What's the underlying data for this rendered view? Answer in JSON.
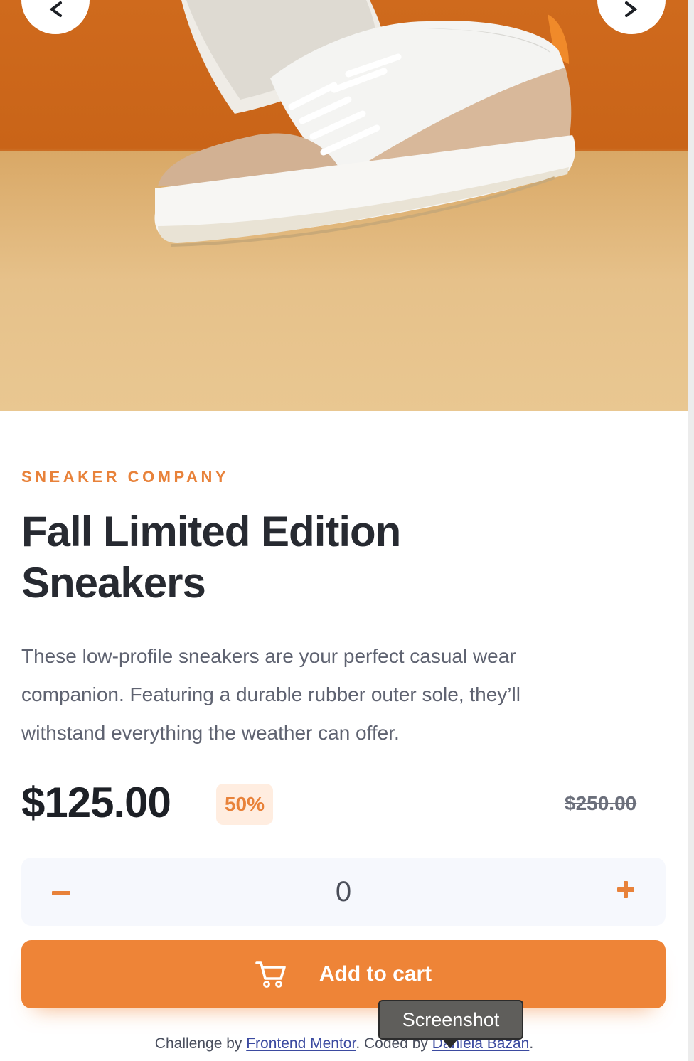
{
  "gallery": {
    "image_alt": "Fall Limited Edition Sneakers product photo",
    "prev_icon": "chevron-left-icon",
    "next_icon": "chevron-right-icon"
  },
  "product": {
    "company": "SNEAKER COMPANY",
    "title": "Fall Limited Edition Sneakers",
    "description": "These low-profile sneakers are your perfect casual wear companion. Featuring a durable rubber outer sole, they’ll withstand everything the weather can offer.",
    "price": "$125.00",
    "discount": "50%",
    "old_price": "$250.00"
  },
  "quantity": {
    "value": "0",
    "minus_icon": "minus-icon",
    "plus_icon": "plus-icon"
  },
  "cart_button": {
    "label": "Add to cart",
    "icon": "cart-icon"
  },
  "footer": {
    "challenge_prefix": "Challenge by",
    "challenge_link": "Frontend Mentor",
    "coded_prefix": ". Coded by",
    "author_link": "Daniela Bazán",
    "suffix": "."
  },
  "tooltip": {
    "text": "Screenshot"
  },
  "colors": {
    "accent": "#ee8437",
    "accent_pale": "#ffede0",
    "title": "#272a31",
    "body_text": "#5f6371",
    "qty_background": "#f6f8fd"
  }
}
